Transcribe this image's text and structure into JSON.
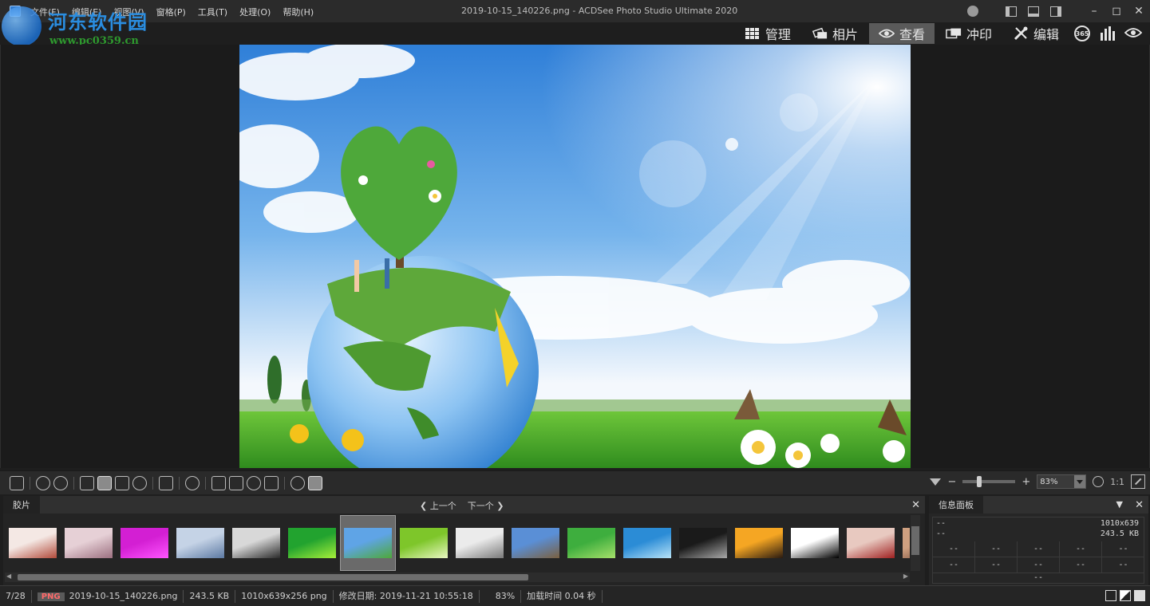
{
  "window": {
    "title": "2019-10-15_140226.png - ACDSee Photo Studio Ultimate 2020"
  },
  "menu": [
    "文件(F)",
    "编辑(E)",
    "视图(V)",
    "窗格(P)",
    "工具(T)",
    "处理(O)",
    "帮助(H)"
  ],
  "watermark": {
    "name": "河东软件园",
    "url": "www.pc0359.cn"
  },
  "modes": [
    {
      "label": "管理",
      "icon": "grid-icon"
    },
    {
      "label": "相片",
      "icon": "photos-icon"
    },
    {
      "label": "查看",
      "icon": "eye-icon",
      "active": true
    },
    {
      "label": "冲印",
      "icon": "develop-icon"
    },
    {
      "label": "编辑",
      "icon": "edit-icon"
    }
  ],
  "mode_extra": {
    "badge_365": "365"
  },
  "toolbar": {
    "zoom_value": "83%",
    "zoom_fraction": 0.3,
    "one_to_one": "1:1"
  },
  "filmstrip": {
    "tab": "胶片",
    "prev": "上一个",
    "next": "下一个",
    "selected_index": 6,
    "thumbnails": [
      {
        "name": "thumb-collage-baby",
        "colors": [
          "#f4e8e4",
          "#b24a3a"
        ]
      },
      {
        "name": "thumb-portrait-pink",
        "colors": [
          "#e6d0d6",
          "#9c7080"
        ]
      },
      {
        "name": "thumb-magenta",
        "colors": [
          "#d31fd3",
          "#ff55ff"
        ]
      },
      {
        "name": "thumb-bluecard",
        "colors": [
          "#c5d3e6",
          "#5d7aa3"
        ]
      },
      {
        "name": "thumb-bw-landscape",
        "colors": [
          "#d8d8d8",
          "#2a2a2a"
        ]
      },
      {
        "name": "thumb-green-wave",
        "colors": [
          "#22a32f",
          "#a6f03a"
        ]
      },
      {
        "name": "thumb-earth-tree",
        "colors": [
          "#5fa4e6",
          "#4ea83a"
        ]
      },
      {
        "name": "thumb-dandelion",
        "colors": [
          "#7ec62a",
          "#e9f7c2"
        ]
      },
      {
        "name": "thumb-ink-mountain",
        "colors": [
          "#ebebeb",
          "#7a7a7a"
        ]
      },
      {
        "name": "thumb-wolf",
        "colors": [
          "#5a8fd6",
          "#7a6040"
        ]
      },
      {
        "name": "thumb-green-gradient",
        "colors": [
          "#3eae3e",
          "#a6e06a"
        ]
      },
      {
        "name": "thumb-ocean",
        "colors": [
          "#2b8cd6",
          "#b7e3f7"
        ]
      },
      {
        "name": "thumb-car-dark",
        "colors": [
          "#1a1a1a",
          "#a8a8a8"
        ]
      },
      {
        "name": "thumb-sunset-couple",
        "colors": [
          "#f5a623",
          "#2a1a10"
        ]
      },
      {
        "name": "thumb-bw-pattern",
        "colors": [
          "#ffffff",
          "#000000"
        ]
      },
      {
        "name": "thumb-collage-red",
        "colors": [
          "#e8c9c0",
          "#a02020"
        ]
      },
      {
        "name": "thumb-partial",
        "colors": [
          "#cfa080",
          "#6a4030"
        ]
      }
    ]
  },
  "info_panel": {
    "tab": "信息面板",
    "row1_left": "--",
    "row1_right": "1010x639",
    "row2_left": "--",
    "row2_right": "243.5 KB",
    "grid": [
      "--",
      "--",
      "--",
      "--",
      "--",
      "--",
      "--",
      "--",
      "--",
      "--"
    ],
    "bottom": "--"
  },
  "status": {
    "position": "7/28",
    "format": "PNG",
    "filename": "2019-10-15_140226.png",
    "size": "243.5 KB",
    "dimensions": "1010x639x256 png",
    "modified": "修改日期: 2019-11-21 10:55:18",
    "zoom": "83%",
    "load_time": "加载时间 0.04 秒"
  },
  "colors": {
    "accent": "#2f7bd1",
    "active_mode": "#5a5a5a",
    "png_badge": "#ff6a6a"
  }
}
